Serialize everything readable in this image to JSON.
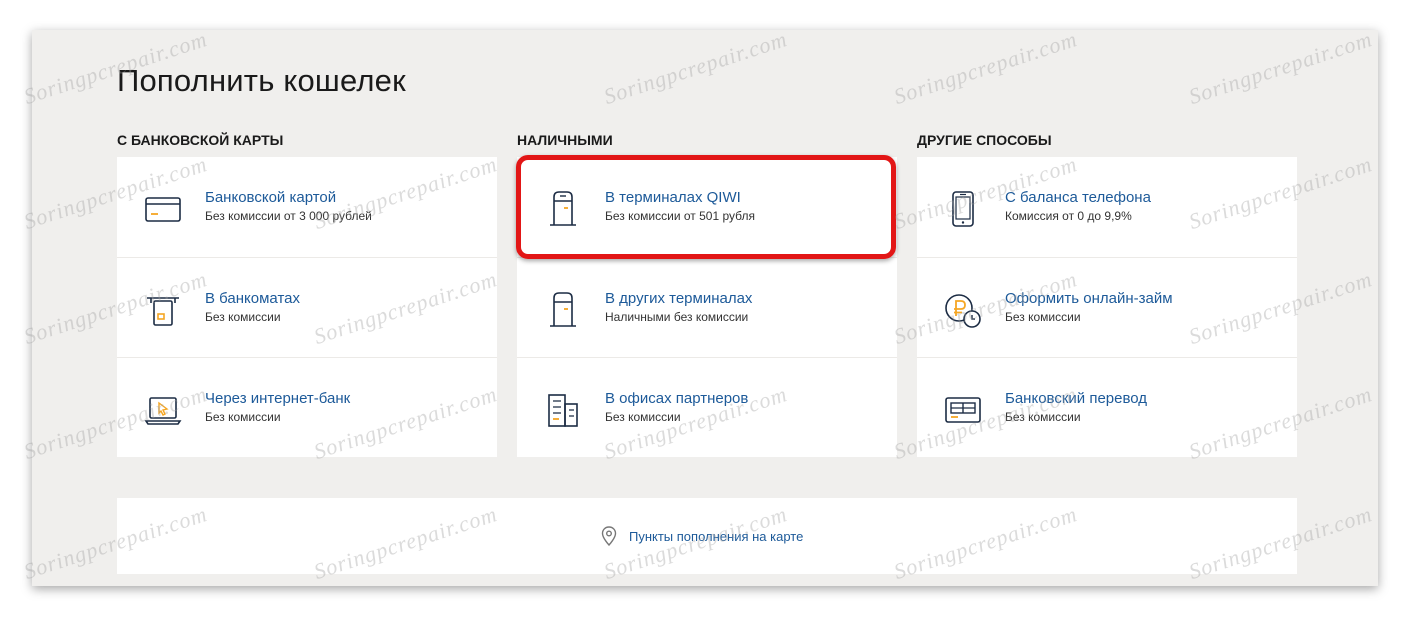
{
  "page": {
    "title": "Пополнить кошелек"
  },
  "columns": [
    {
      "heading": "С банковской карты",
      "items": [
        {
          "title": "Банковской картой",
          "subtitle": "Без комиссии от 3 000 рублей",
          "icon": "bank-card-icon"
        },
        {
          "title": "В банкоматах",
          "subtitle": "Без комиссии",
          "icon": "atm-icon"
        },
        {
          "title": "Через интернет-банк",
          "subtitle": "Без комиссии",
          "icon": "laptop-icon"
        }
      ]
    },
    {
      "heading": "Наличными",
      "items": [
        {
          "title": "В терминалах QIWI",
          "subtitle": "Без комиссии от 501 рубля",
          "icon": "qiwi-terminal-icon"
        },
        {
          "title": "В других терминалах",
          "subtitle": "Наличными без комиссии",
          "icon": "terminal-icon"
        },
        {
          "title": "В офисах партнеров",
          "subtitle": "Без комиссии",
          "icon": "office-buildings-icon"
        }
      ]
    },
    {
      "heading": "Другие способы",
      "items": [
        {
          "title": "С баланса телефона",
          "subtitle": "Комиссия от 0 до 9,9%",
          "icon": "mobile-phone-icon"
        },
        {
          "title": "Оформить онлайн-займ",
          "subtitle": "Без комиссии",
          "icon": "ruble-loan-icon"
        },
        {
          "title": "Банковский перевод",
          "subtitle": "Без комиссии",
          "icon": "bank-transfer-icon"
        }
      ]
    }
  ],
  "map": {
    "label": "Пункты пополнения на карте",
    "icon": "map-pin-icon"
  },
  "watermark": "Soringpcrepair.com",
  "colors": {
    "link": "#1d5a99",
    "accent": "#f5a623",
    "highlight": "#e21616",
    "background": "#f0efed"
  }
}
